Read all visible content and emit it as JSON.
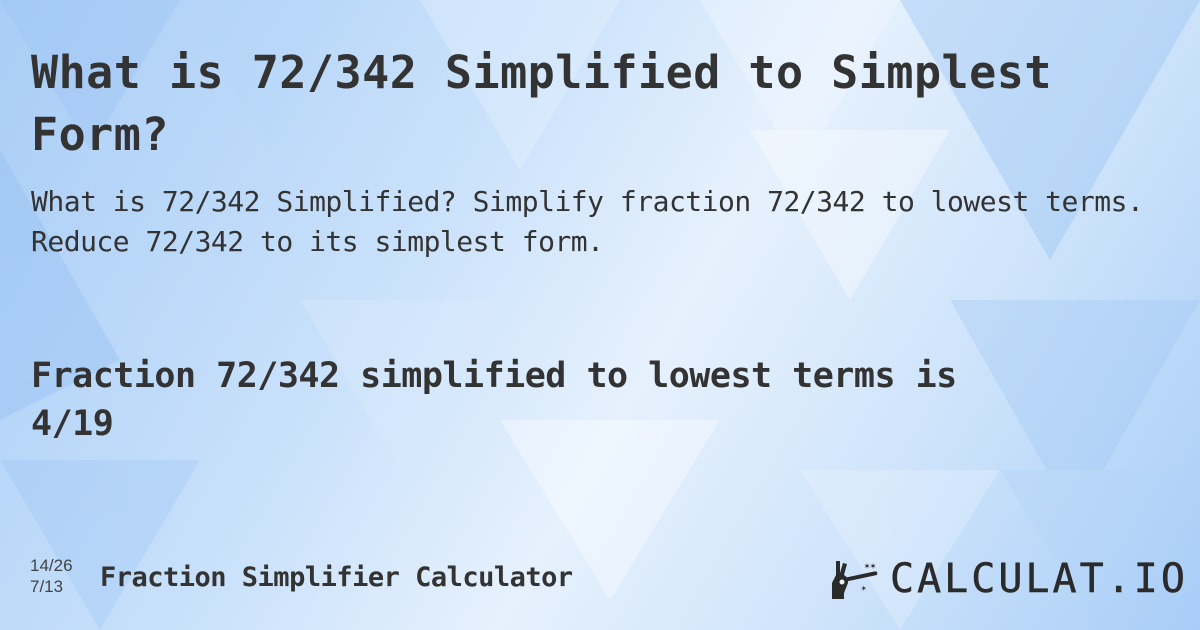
{
  "page": {
    "title": "What is 72/342 Simplified to Simplest Form?",
    "subtitle": "What is 72/342 Simplified? Simplify fraction 72/342 to lowest terms. Reduce 72/342 to its simplest form.",
    "answer_line1": "Fraction 72/342 simplified to lowest terms is",
    "answer_line2": "4/19"
  },
  "footer": {
    "fraction_top": "14/26",
    "fraction_bottom": "7/13",
    "calculator_name": "Fraction Simplifier Calculator",
    "logo_icon": "magic-wand-hand-icon",
    "logo_text": "CALCULAT.IO"
  },
  "colors": {
    "text": "#333333",
    "background_light": "#e6f1fd",
    "background_blue": "#a9cdf6"
  }
}
